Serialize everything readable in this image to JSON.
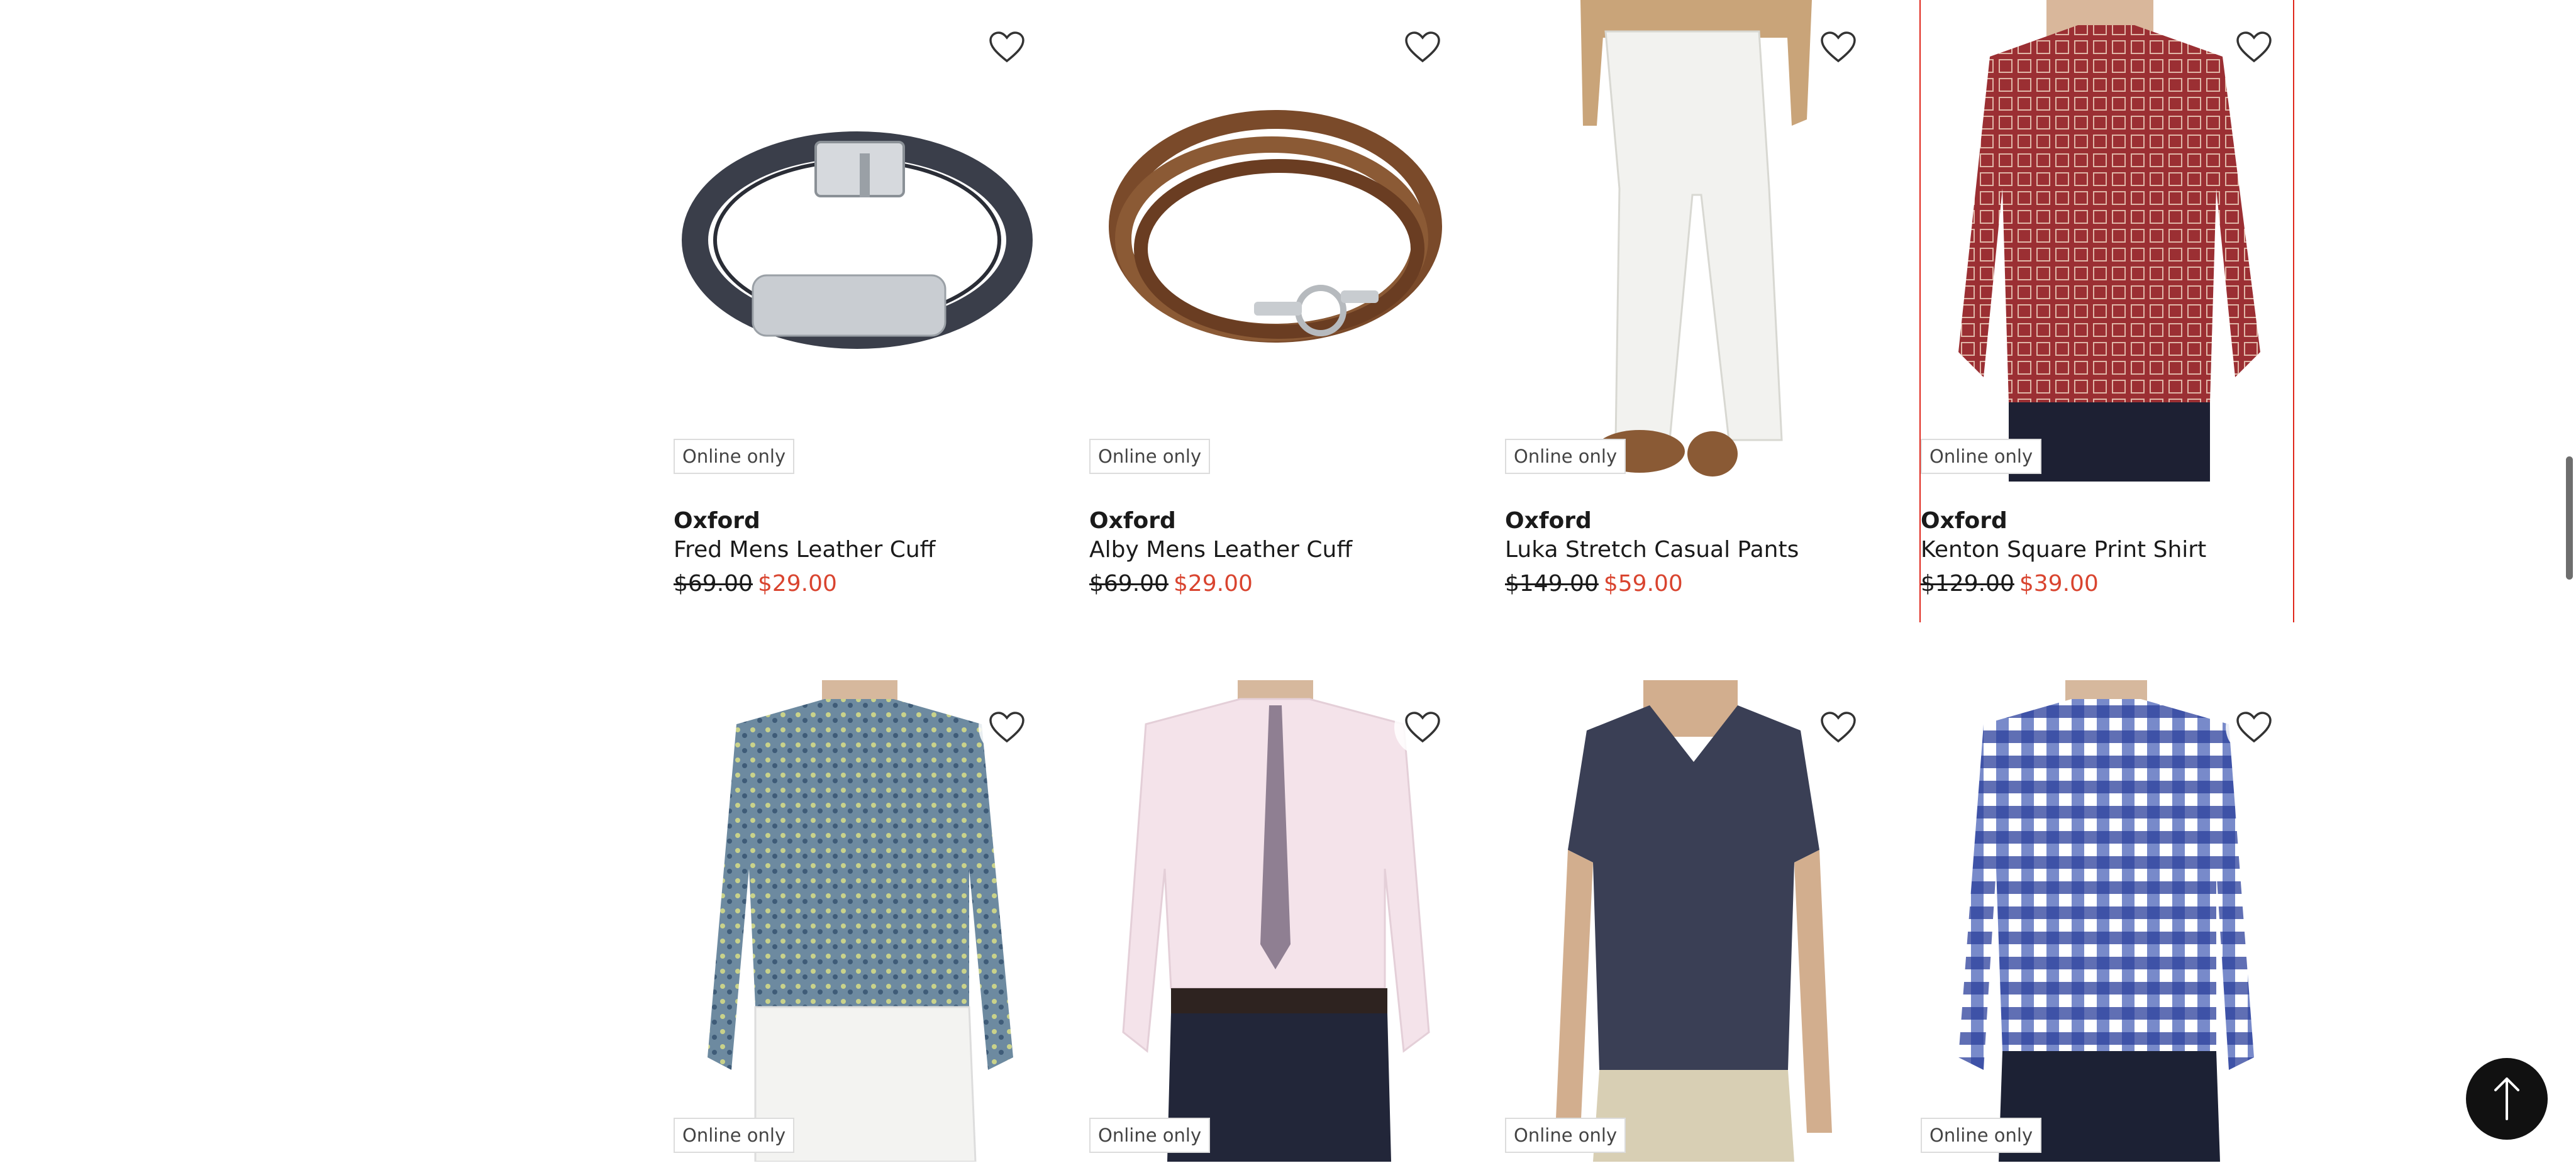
{
  "products": [
    {
      "badge": "Online only",
      "brand": "Oxford",
      "name": "Fred Mens Leather Cuff",
      "price_was": "$69.00",
      "price_now": "$29.00",
      "image_icon": "bracelet-black-leather"
    },
    {
      "badge": "Online only",
      "brand": "Oxford",
      "name": "Alby Mens Leather Cuff",
      "price_was": "$69.00",
      "price_now": "$29.00",
      "image_icon": "bracelet-brown-braided"
    },
    {
      "badge": "Online only",
      "brand": "Oxford",
      "name": "Luka Stretch Casual Pants",
      "price_was": "$149.00",
      "price_now": "$59.00",
      "image_icon": "white-chino-pants"
    },
    {
      "badge": "Online only",
      "brand": "Oxford",
      "name": "Kenton Square Print Shirt",
      "price_was": "$129.00",
      "price_now": "$39.00",
      "image_icon": "red-print-shirt"
    },
    {
      "badge": "Online only",
      "image_icon": "blue-floral-shirt"
    },
    {
      "badge": "Online only",
      "image_icon": "pink-dress-shirt-tie"
    },
    {
      "badge": "Online only",
      "image_icon": "navy-vneck-tee"
    },
    {
      "badge": "Online only",
      "image_icon": "blue-gingham-shirt"
    }
  ],
  "icons": {
    "wishlist": "heart-icon",
    "back_to_top": "arrow-up-icon"
  },
  "colors": {
    "sale_price": "#d9442f",
    "selected_outline": "#e0261b",
    "badge_border": "#dcdcdc"
  }
}
